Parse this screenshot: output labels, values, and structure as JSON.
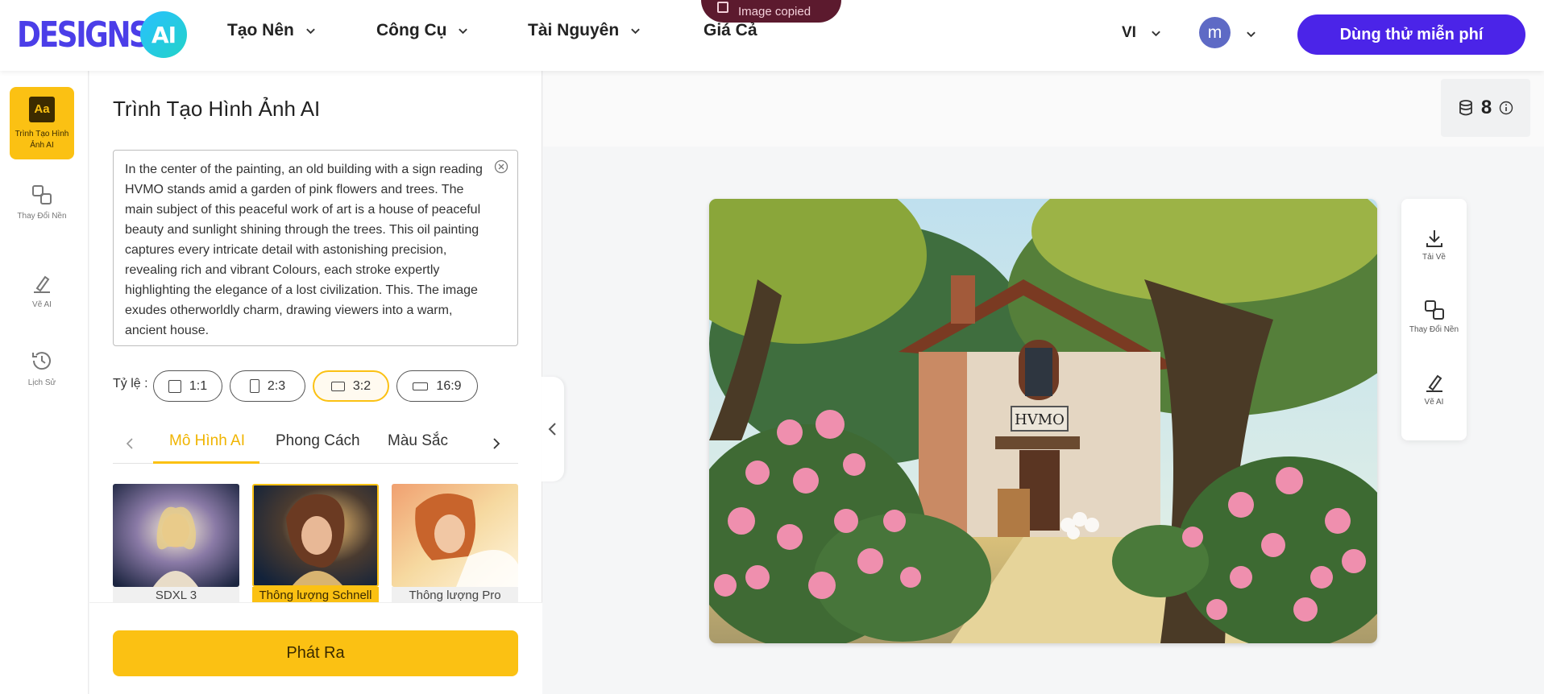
{
  "header": {
    "logo": {
      "text_main": "DESIGNS.",
      "text_accent": "AI"
    },
    "nav": [
      {
        "label": "Tạo Nên",
        "has_dropdown": true
      },
      {
        "label": "Công Cụ",
        "has_dropdown": true
      },
      {
        "label": "Tài Nguyên",
        "has_dropdown": true
      },
      {
        "label": "Giá Cả",
        "has_dropdown": false
      }
    ],
    "toast": "Image copied",
    "language": "VI",
    "avatar_letter": "m",
    "cta_label": "Dùng thử miễn phí",
    "cta_color": "#4b24e8"
  },
  "sidebar": {
    "items": [
      {
        "label": "Trình Tạo Hình Ảnh AI",
        "icon": "text-aa-icon",
        "active": true
      },
      {
        "label": "Thay Đổi Nền",
        "icon": "swap-background-icon",
        "active": false
      },
      {
        "label": "Vẽ AI",
        "icon": "pen-draw-icon",
        "active": false
      },
      {
        "label": "Lịch Sử",
        "icon": "history-icon",
        "active": false
      }
    ]
  },
  "panel": {
    "title": "Trình Tạo Hình Ảnh AI",
    "prompt": "In the center of the painting, an old building with a sign reading HVMO stands amid a garden of pink flowers and trees. The main subject of this peaceful work of art is a house of peaceful beauty and sunlight shining through the trees. This oil painting captures every intricate detail with astonishing precision, revealing rich and vibrant Colours, each stroke expertly highlighting the elegance of a lost civilization. This. The image exudes otherworldly charm, drawing viewers into a warm, ancient house.",
    "ratio_label": "Tỷ lệ :",
    "ratios": [
      {
        "label": "1:1",
        "active": false
      },
      {
        "label": "2:3",
        "active": false
      },
      {
        "label": "3:2",
        "active": true
      },
      {
        "label": "16:9",
        "active": false
      }
    ],
    "tabs": [
      {
        "label": "Mô Hình AI",
        "active": true
      },
      {
        "label": "Phong Cách",
        "active": false
      },
      {
        "label": "Màu Sắc",
        "active": false
      }
    ],
    "models": [
      {
        "label": "SDXL 3",
        "active": false
      },
      {
        "label": "Thông lượng Schnell",
        "active": true
      },
      {
        "label": "Thông lượng Pro",
        "active": false
      }
    ],
    "generate_label": "Phát Ra",
    "accent_color": "#fbc113"
  },
  "canvas": {
    "credits": "8",
    "image_sign": "HVMO",
    "tools": [
      {
        "label": "Tải Về",
        "icon": "download-icon"
      },
      {
        "label": "Thay Đổi Nền",
        "icon": "swap-background-icon"
      },
      {
        "label": "Vẽ AI",
        "icon": "pen-draw-icon"
      }
    ]
  }
}
